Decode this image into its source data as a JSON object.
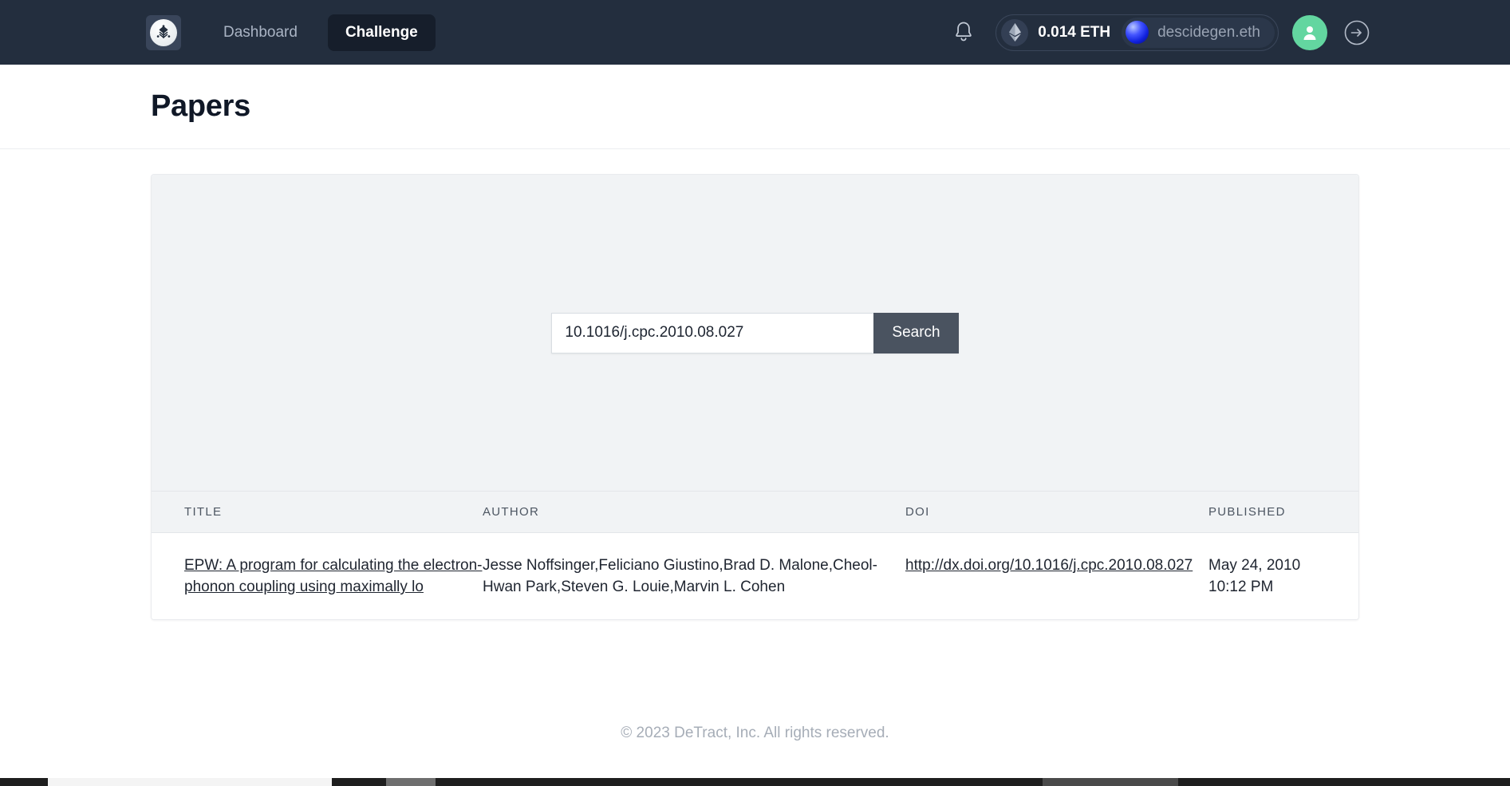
{
  "navbar": {
    "logo_icon": "detract-logo-icon",
    "links": [
      {
        "label": "Dashboard",
        "icon": ""
      },
      {
        "label": "Challenge",
        "icon": ""
      }
    ],
    "notification_icon": "bell-icon",
    "wallet": {
      "eth_icon": "ethereum-diamond-icon",
      "balance": "0.014 ETH",
      "ens_avatar_icon": "ens-sphere-avatar-icon",
      "ens_name": "descidegen.eth"
    },
    "profile_avatar_icon": "person-avatar-icon",
    "logout_icon": "arrow-right-circle-icon",
    "colors": {
      "navbar_bg": "#232e3e",
      "active_pill_bg": "#161e2b",
      "avatar_green": "#63d6a0",
      "link_muted": "#aab4c4"
    }
  },
  "header": {
    "title": "Papers"
  },
  "search": {
    "value": "10.1016/j.cpc.2010.08.027",
    "placeholder": "Enter DOI",
    "button_label": "Search",
    "panel_bg": "#f1f3f5",
    "button_bg": "#4a5360"
  },
  "table": {
    "columns": [
      {
        "key": "title",
        "label": "TITLE"
      },
      {
        "key": "author",
        "label": "AUTHOR"
      },
      {
        "key": "doi",
        "label": "DOI"
      },
      {
        "key": "published",
        "label": "PUBLISHED"
      }
    ],
    "rows": [
      {
        "title": "EPW: A program for calculating the electron-phonon coupling using maximally lo",
        "author": "Jesse Noffsinger,Feliciano Giustino,Brad D. Malone,Cheol-Hwan Park,Steven G. Louie,Marvin L. Cohen",
        "doi": "http://dx.doi.org/10.1016/j.cpc.2010.08.027",
        "published_date": "May 24, 2010",
        "published_time": "10:12 PM"
      }
    ]
  },
  "footer": {
    "text": "© 2023 DeTract, Inc. All rights reserved."
  }
}
